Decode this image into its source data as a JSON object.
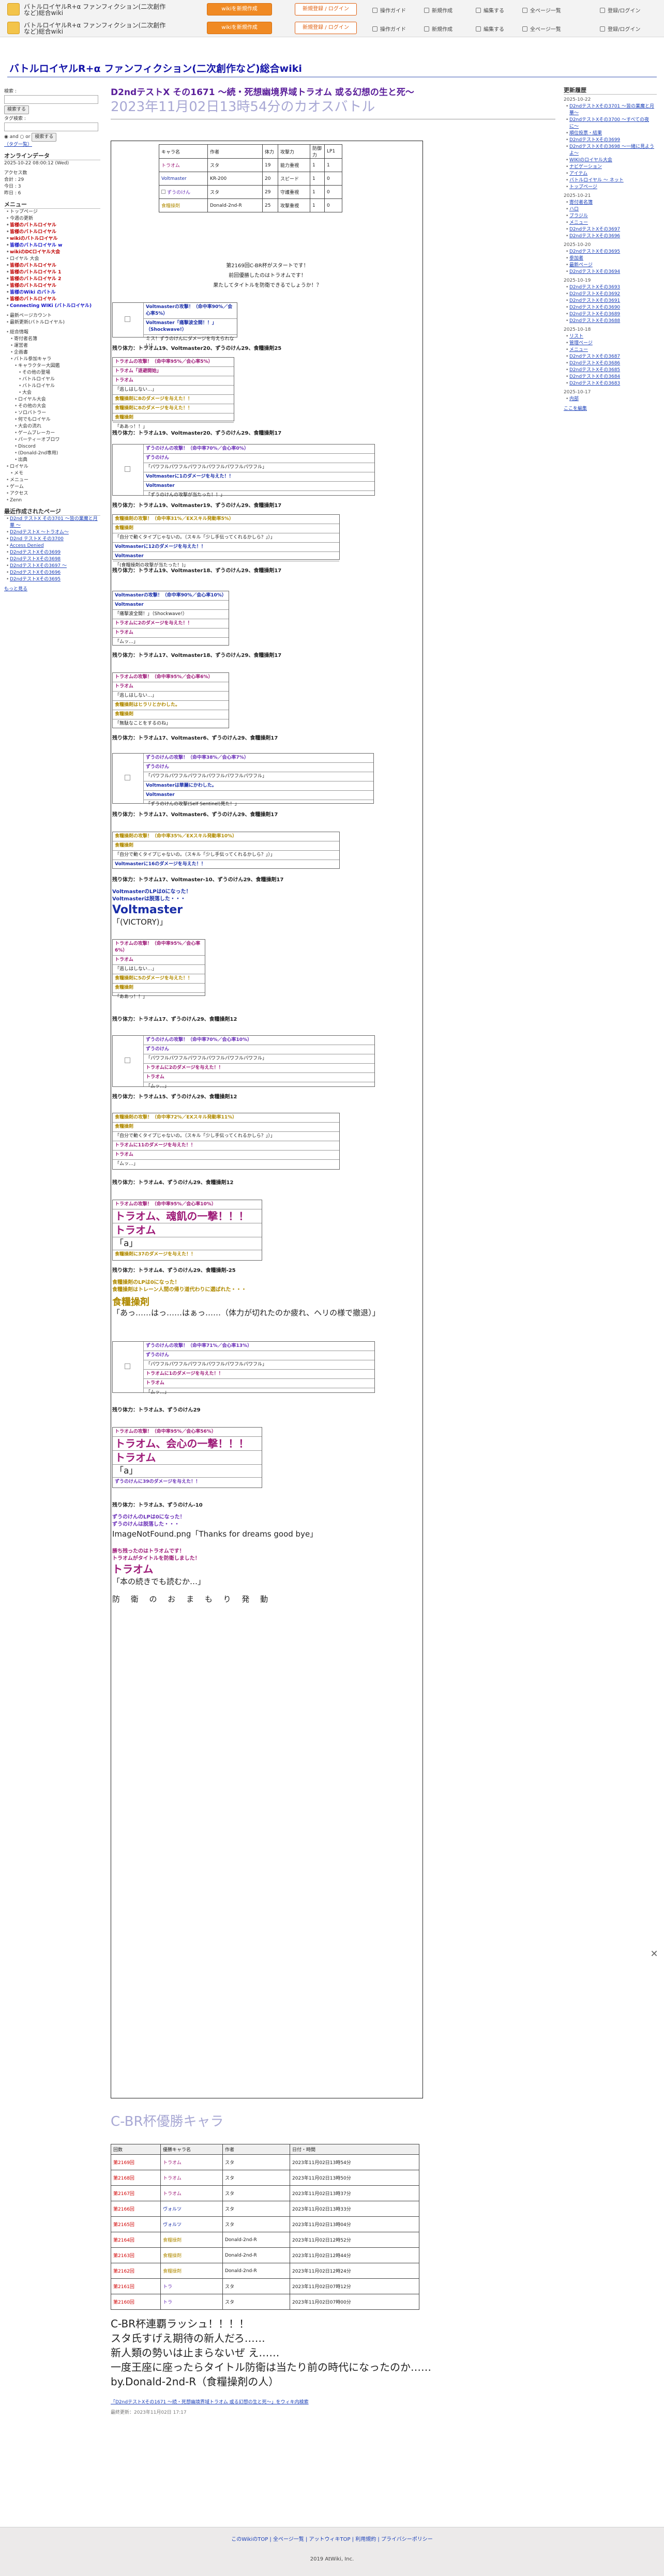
{
  "header": {
    "site_name_line1": "バトルロイヤルR+α ファンフィクション(二次創作",
    "site_name_line2": "など)総合wiki",
    "buttons": [
      "wikiを新規作成",
      "新規登録 / ログイン",
      "wikiを新規作成"
    ],
    "links": [
      "操作ガイド",
      "新規作成",
      "編集する",
      "全ページ一覧",
      "登録/ログイン"
    ]
  },
  "wiki_title": "バトルロイヤルR+α ファンフィクション(二次創作など)総合wiki",
  "left_sidebar": {
    "search_label": "検索 :",
    "search_button": "検索する",
    "tag_label": "タグ検索 :",
    "tag_button": "検索する",
    "tag_option": "and",
    "tag_option2": "or",
    "tag_list_link": "（タグ一覧）",
    "online_title": "オンラインデータ",
    "online_stats": [
      "2025-10-22 08:00:12 (Wed)",
      "アクセス数",
      "合計 : 29",
      "今日 : 3",
      "昨日 : 6"
    ],
    "menu_title": "メニュー",
    "menu_items": [
      "トップページ",
      "今週の更新",
      "皆様のバトルロイヤル",
      "皆様のバトルロイヤル",
      "wikiのバトルロイヤル",
      "皆様のバトルロイヤル w",
      "wikiのDCロイヤル大会",
      "ロイヤル 大会",
      "皆様のバトルロイヤル",
      "皆様のバトルロイヤル 1",
      "皆様のバトルロイヤル 2",
      "皆様のバトルロイヤル",
      "皆様のWiki のバトル",
      "皆様のバトルロイヤル",
      "Connecting WIKi (バトルロイヤル)"
    ],
    "sub_title": "最新更新",
    "sub_items": [
      "最新ページカウント",
      "最新更新(バトルロイヤル)"
    ],
    "tree_items": [
      "総合情報",
      "寄付者名簿",
      "運営者",
      "企画書",
      "バトル参加キャラ",
      "キャラクター大図鑑",
      "その他の登場",
      "バトルロイヤル",
      "バトルロイヤル",
      "大会",
      "ロイヤル大会",
      "その他の大会",
      "ソロバトラー",
      "何でもロイヤル",
      "大会の流れ",
      "ゲームブレーカー",
      "パーティーオブロワ",
      "Discord",
      "(Donald-2nd専用)",
      "出典",
      "ロイヤル",
      "メモ",
      "メニュー",
      "ゲーム",
      "アクセス",
      "Zenn"
    ],
    "recent_title": "最近作成されたページ",
    "recent_items": [
      "D2nd テストX その3701 〜皆の業魔と月華 〜",
      "D2ndテストX 〜トラオム〜",
      "D2nd テストX その3700",
      "Access Denied",
      "D2ndテストXその3699",
      "D2ndテストXその3698",
      "D2ndテストXその3697 〜",
      "D2ndテストXその3696",
      "D2ndテストXその3695"
    ],
    "more_link": "もっと見る"
  },
  "right_sidebar": {
    "title": "更新履歴",
    "groups": [
      {
        "date": "2025-10-22",
        "items": [
          "D2ndテストXその3701 〜皆の業魔と月華〜",
          "D2ndテストXその3700 〜すべての夜に〜",
          "順位投票・結果",
          "D2ndテストXその3699",
          "D2ndテストXその3698 〜一緒に見ようよ〜",
          "WIKIのロイヤル大会",
          "ナビゲーション",
          "アイテム",
          "バトルロイヤル 〜 ネット",
          "トップページ"
        ]
      },
      {
        "date": "2025-10-21",
        "items": [
          "寄付者名簿",
          "ハロ",
          "ブラジル",
          "メニュー",
          "D2ndテストXその3697",
          "D2ndテストXその3696"
        ]
      },
      {
        "date": "2025-10-20",
        "items": [
          "D2ndテストXその3695",
          "参加者",
          "最新ページ",
          "D2ndテストXその3694"
        ]
      },
      {
        "date": "2025-10-19",
        "items": [
          "D2ndテストXその3693",
          "D2ndテストXその3692",
          "D2ndテストXその3691",
          "D2ndテストXその3690",
          "D2ndテストXその3689",
          "D2ndテストXその3688"
        ]
      },
      {
        "date": "2025-10-18",
        "items": [
          "リスト",
          "管理ページ",
          "メニュー",
          "D2ndテストXその3687",
          "D2ndテストXその3686",
          "D2ndテストXその3685",
          "D2ndテストXその3684",
          "D2ndテストXその3683"
        ]
      },
      {
        "date": "2025-10-17",
        "items": [
          "内部"
        ]
      }
    ],
    "more_link": "ここを編集"
  },
  "main": {
    "page_title": "D2ndテストX その1671 〜続・死想幽境界域トラオム 或る幻想の生と死〜",
    "page_subtitle": "2023年11月02日13時54分のカオスバトル",
    "cast_table": [
      [
        "キャラ名",
        "作者",
        "体力",
        "攻撃力",
        "防御力",
        "LP1",
        "LP2"
      ],
      [
        "トラオム",
        "スタ",
        "19",
        "能力重視",
        "1",
        "1",
        ""
      ],
      [
        "Voltmaster",
        "KR-200",
        "20",
        "スピード",
        "1",
        "0",
        ""
      ],
      [
        "ずうのけん",
        "スタ",
        "29",
        "守護重視",
        "1",
        "0",
        ""
      ],
      [
        "食糧操剤",
        "Donald-2nd-R",
        "25",
        "攻撃重視",
        "1",
        "0",
        ""
      ]
    ],
    "intro_lines": [
      "第2169回C-BR杯がスタートです！",
      "前回優勝したのはトラオムです！",
      "果たしてタイトルを防衛できるでしょうか！？"
    ],
    "turn_label": "残り体力：",
    "log_image_label": "ImageNotFound.png",
    "turns": [
      "残り体力：トラオム19、Voltmaster20、ずうのけん29、食糧操剤25",
      "残り体力：トラオム19、Voltmaster20、ずうのけん29、食糧操剤17",
      "残り体力：トラオム19、Voltmaster19、ずうのけん29、食糧操剤17",
      "残り体力：トラオム19、Voltmaster18、ずうのけん29、食糧操剤17",
      "残り体力：トラオム17、Voltmaster18、ずうのけん29、食糧操剤17",
      "残り体力：トラオム17、Voltmaster6、ずうのけん29、食糧操剤17",
      "残り体力：トラオム17、Voltmaster6、ずうのけん29、食糧操剤17",
      "残り体力：トラオム17、Voltmaster-10、ずうのけん29、食糧操剤17",
      "残り体力：トラオム17、ずうのけん29、食糧操剤12",
      "残り体力：トラオム15、ずうのけん29、食糧操剤12",
      "残り体力：トラオム4、ずうのけん29、食糧操剤12",
      "残り体力：トラオム4、ずうのけん29、食糧操剤-25",
      "残り体力：トラオム3、ずうのけん29",
      "残り体力：トラオム3、ずうのけん-10"
    ],
    "logs": {
      "l1": [
        "Voltmasterの攻撃！（命中率90%／会心率5%）",
        "Voltmaster「痛撃波全開！！」（Shockwave!）",
        "ミス！ずうのけんにダメージを与えられない！"
      ],
      "l2": [
        "トラオムの攻撃！（命中率95%／会心率5%）",
        "トラオム「退避開始」",
        "トラオム",
        "「逃しはしない…」",
        "食糧操剤に8のダメージを与えた！！",
        "食糧操剤に8のダメージを与えた！！",
        "食糧操剤",
        "「ああっ！！」"
      ],
      "l3": [
        "ずうのけんの攻撃！（命中率70%／会心率0%）",
        "ずうのけん",
        "「パワフルパワフルパワフルパワフルパワフルパワフル」",
        "Voltmasterに1のダメージを与えた！！",
        "Voltmaster",
        "「ずうのけんの攻撃が当たった！！」"
      ],
      "l4": [
        "食糧操剤の攻撃！（命中率31%／EXスキル発動率5%）",
        "食糧操剤",
        "「自分で動くタイプじゃないの。（スキル「少し手伝ってくれるかしら？」）」",
        "Voltmasterに12のダメージを与えた！！",
        "Voltmaster",
        "「(食糧操剤の攻撃が当たった！)」"
      ],
      "l5": [
        "Voltmasterの攻撃！（命中率90%／会心率10%）",
        "Voltmaster",
        "「痛撃波全開！」（Shockwave!）",
        "トラオムに2のダメージを与えた！！",
        "トラオム",
        "「ムッ…」"
      ],
      "l6": [
        "トラオムの攻撃！（命中率95%／会心率6%）",
        "トラオム",
        "「逃しはしない…」",
        "食糧操剤はヒラリとかわした。",
        "食糧操剤",
        "「無駄なことをするのね」"
      ],
      "l7": [
        "ずうのけんの攻撃！（命中率38%／会心率7%）",
        "ずうのけん",
        "「パワフルパワフルパワフルパワフルパワフルパワフル」",
        "Voltmasterは華麗にかわした。",
        "Voltmaster",
        "「ずうのけんの攻撃(Self Sentinel)見た！」"
      ],
      "l8": [
        "食糧操剤の攻撃！（命中率35%／EXスキル発動率10%）",
        "食糧操剤",
        "「自分で動くタイプじゃないの。（スキル「少し手伝ってくれるかしら？」）」",
        "Voltmasterに16のダメージを与えた！！"
      ],
      "v_lines": [
        "VoltmasterのLPは0になった！",
        "Voltmasterは脱落した・・・"
      ],
      "v_big": "Voltmaster",
      "v_quote": "「(VICTORY)」",
      "l9": [
        "トラオムの攻撃！（命中率95%／会心率6%）",
        "トラオム",
        "「逃しはしない…」",
        "食糧操剤に5のダメージを与えた！！",
        "食糧操剤",
        "「ああっ！！」"
      ],
      "l10": [
        "ずうのけんの攻撃！（命中率70%／会心率10%）",
        "ずうのけん",
        "「パワフルパワフルパワフルパワフルパワフルパワフル」",
        "トラオムに2のダメージを与えた！！",
        "トラオム",
        "「ムッ…」"
      ],
      "l11": [
        "食糧操剤の攻撃！（命中率72%／EXスキル発動率11%）",
        "食糧操剤",
        "「自分で動くタイプじゃないの。（スキル「少し手伝ってくれるかしら？」）」",
        "トラオムに11のダメージを与えた！！",
        "トラオム",
        "「ムッ…」"
      ],
      "l12": [
        "トラオムの攻撃！（命中率95%／会心率10%）",
        "トラオム、魂飢の一撃！！！",
        "トラオム",
        "「a」",
        "食糧操剤に37のダメージを与えた！！"
      ],
      "s_lines": [
        "食糧操剤のLPは0になった！",
        "食糧操剤はトレーン人間の帰り道代わりに選ばれた・・・"
      ],
      "s_big": "食糧操剤",
      "s_quote": "「あっ……はっ……はぁっ……（体力が切れたのか疲れ、ヘリの様で撤退）」",
      "l13": [
        "ずうのけんの攻撃！（命中率71%／会心率13%）",
        "ずうのけん",
        "「パワフルパワフルパワフルパワフルパワフルパワフル」",
        "トラオムに1のダメージを与えた！！",
        "トラオム",
        "「ムッ…」"
      ],
      "l14": [
        "トラオムの攻撃！（命中率95%／会心率56%）",
        "トラオム、会心の一撃！！！",
        "トラオム",
        "「a」",
        "ずうのけんに39のダメージを与えた！！"
      ],
      "z_lines": [
        "ずうのけんのLPは0になった！",
        "ずうのけんは脱落した・・・"
      ],
      "z_quote": "ImageNotFound.png「Thanks for dreams good bye」",
      "w_lines": [
        "勝ち残ったのはトラオムです！",
        "トラオムがタイトルを防衛しました！"
      ],
      "w_big": "トラオム",
      "w_quote": "「本の続きでも読むか…」",
      "w_end": "防 衛 の お ま も り 発 動"
    },
    "cbr_title": "C-BR杯優勝キャラ",
    "winner_headers": [
      "回数",
      "優勝キャラ名",
      "作者",
      "日付・時間"
    ],
    "winners": [
      [
        "第2169回",
        "トラオム",
        "スタ",
        "2023年11月02日13時54分"
      ],
      [
        "第2168回",
        "トラオム",
        "スタ",
        "2023年11月02日13時50分"
      ],
      [
        "第2167回",
        "トラオム",
        "スタ",
        "2023年11月02日13時37分"
      ],
      [
        "第2166回",
        "ヴォルツ",
        "スタ",
        "2023年11月02日13時33分"
      ],
      [
        "第2165回",
        "ヴォルツ",
        "スタ",
        "2023年11月02日13時04分"
      ],
      [
        "第2164回",
        "食糧操剤",
        "Donald-2nd-R",
        "2023年11月02日12時52分"
      ],
      [
        "第2163回",
        "食糧操剤",
        "Donald-2nd-R",
        "2023年11月02日12時44分"
      ],
      [
        "第2162回",
        "食糧操剤",
        "Donald-2nd-R",
        "2023年11月02日12時24分"
      ],
      [
        "第2161回",
        "トラ",
        "スタ",
        "2023年11月02日07時12分"
      ],
      [
        "第2160回",
        "トラ",
        "スタ",
        "2023年11月02日07時00分"
      ]
    ],
    "closing_lines": [
      "C-BR杯連覇ラッシュ！！！！",
      "スタ氏すげえ期待の新人だろ……",
      "新人類の勢いは止まらないぜ え……",
      "一度王座に座ったらタイトル防衛は当たり前の時代になったのか……",
      "by.Donald-2nd-R（食糧操剤の人）"
    ],
    "breadcrumb": "「D2ndテストXその1671 〜続・死想幽境界域トラオム 或る幻想の生と死〜」をウィキ内検索",
    "last_modified": "最終更新：2023年11月02日 17:17"
  },
  "footer": {
    "links": "このWikiのTOP | 全ページ一覧 | アットウィキTOP | 利用規約 | プライバシーポリシー",
    "copyright": "2019 AtWiki, Inc."
  }
}
